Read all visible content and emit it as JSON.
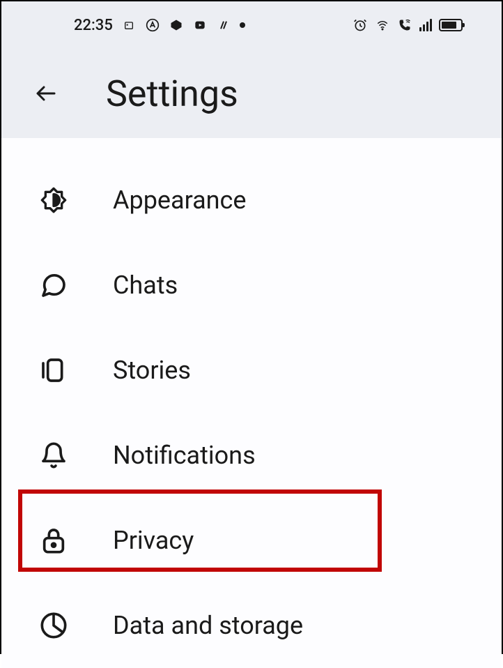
{
  "status": {
    "time": "22:35"
  },
  "header": {
    "title": "Settings"
  },
  "menu": {
    "items": [
      {
        "icon": "brightness",
        "label": "Appearance"
      },
      {
        "icon": "chat",
        "label": "Chats"
      },
      {
        "icon": "stories",
        "label": "Stories"
      },
      {
        "icon": "bell",
        "label": "Notifications"
      },
      {
        "icon": "lock",
        "label": "Privacy"
      },
      {
        "icon": "pie",
        "label": "Data and storage"
      }
    ],
    "highlighted_index": 4
  }
}
